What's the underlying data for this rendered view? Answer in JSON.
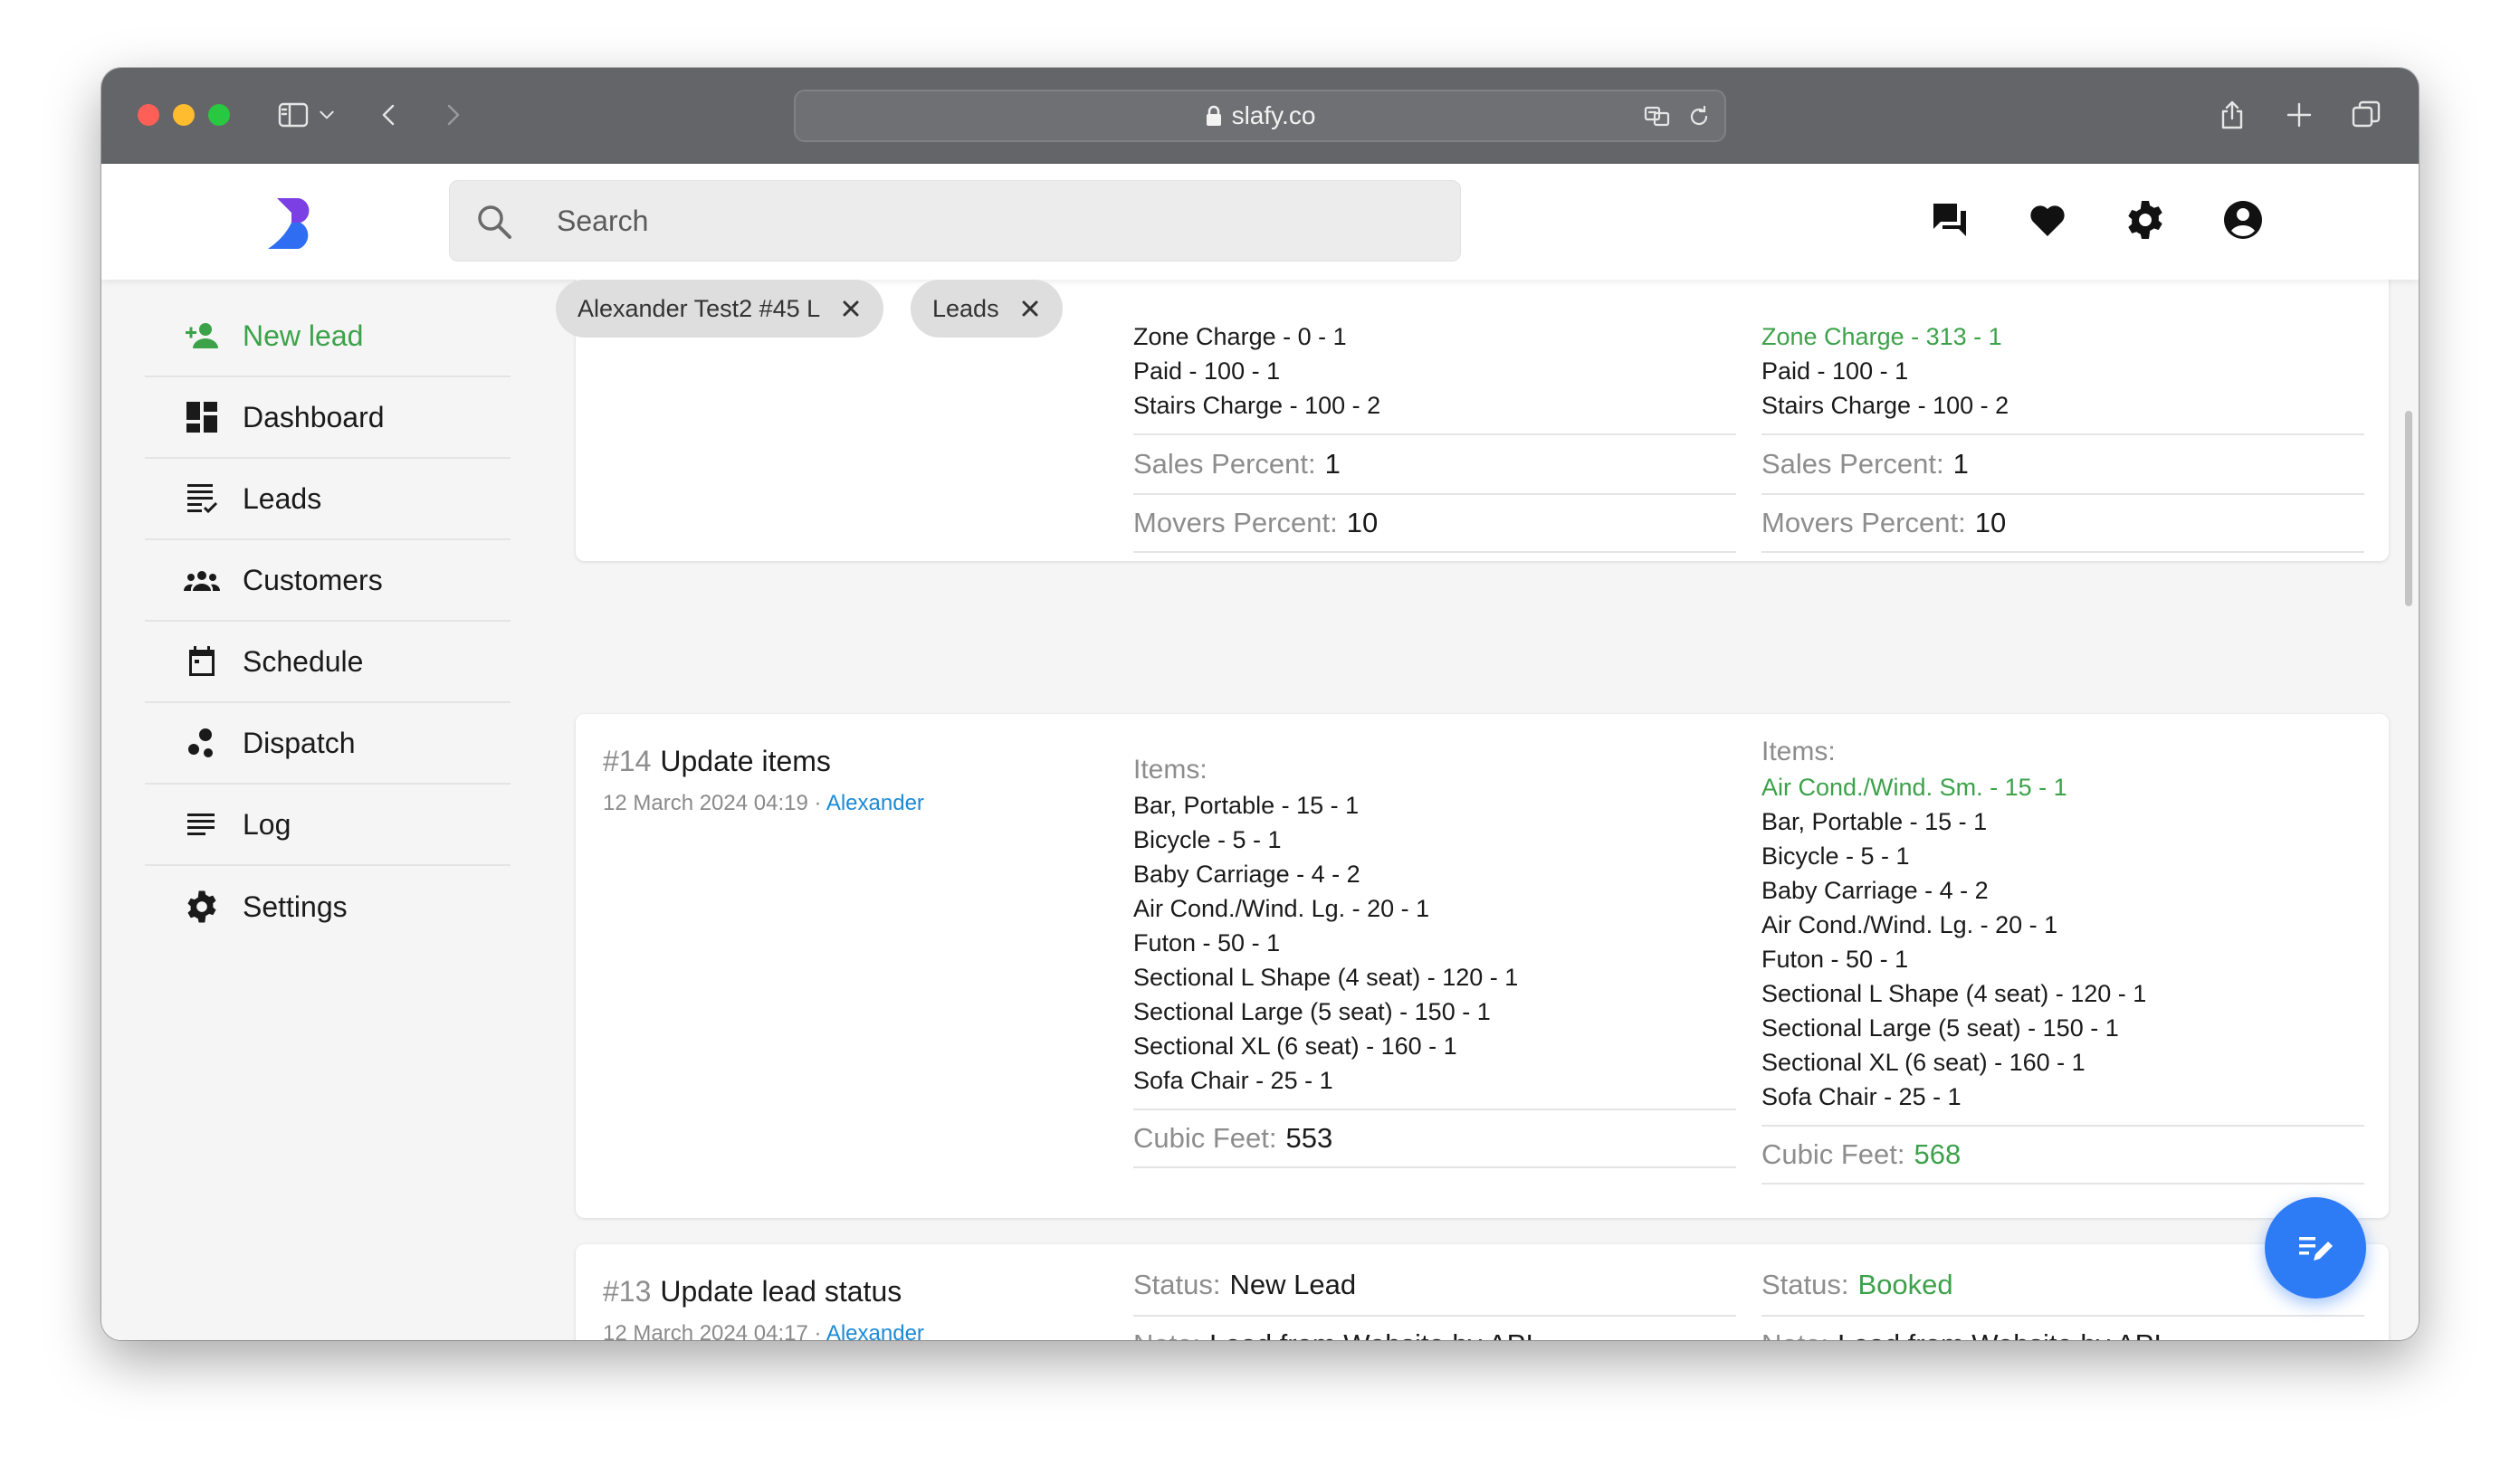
{
  "browser": {
    "url": "slafy.co"
  },
  "search": {
    "placeholder": "Search"
  },
  "tabs": [
    {
      "label": "Alexander Test2 #45 L"
    },
    {
      "label": "Leads"
    }
  ],
  "sidebar": {
    "items": [
      {
        "label": "New lead",
        "icon": "person-add-icon"
      },
      {
        "label": "Dashboard",
        "icon": "dashboard-icon"
      },
      {
        "label": "Leads",
        "icon": "list-check-icon"
      },
      {
        "label": "Customers",
        "icon": "groups-icon"
      },
      {
        "label": "Schedule",
        "icon": "calendar-icon"
      },
      {
        "label": "Dispatch",
        "icon": "dispatch-icon"
      },
      {
        "label": "Log",
        "icon": "log-icon"
      },
      {
        "label": "Settings",
        "icon": "gear-icon"
      }
    ]
  },
  "colors": {
    "accent_green": "#3ca24a",
    "link_blue": "#1b8ad6",
    "fab_blue": "#2e7bf6"
  },
  "cards": {
    "price": {
      "old": {
        "lines": [
          "Zone Charge - 0 - 1",
          "Paid - 100 - 1",
          "Stairs Charge - 100 - 2"
        ],
        "sales_label": "Sales Percent:",
        "sales_value": "1",
        "movers_label": "Movers Percent:",
        "movers_value": "10"
      },
      "new": {
        "lines": [
          "Zone Charge - 313 - 1",
          "Paid - 100 - 1",
          "Stairs Charge - 100 - 2"
        ],
        "sales_label": "Sales Percent:",
        "sales_value": "1",
        "movers_label": "Movers Percent:",
        "movers_value": "10"
      }
    },
    "items": {
      "number": "#14",
      "title": "Update items",
      "date": "12 March 2024 04:19 · ",
      "author": "Alexander",
      "old": {
        "label": "Items:",
        "lines": [
          "Bar, Portable - 15 - 1",
          "Bicycle - 5 - 1",
          "Baby Carriage - 4 - 2",
          "Air Cond./Wind. Lg. - 20 - 1",
          "Futon - 50 - 1",
          "Sectional L Shape (4 seat) - 120 - 1",
          "Sectional Large (5 seat) - 150 - 1",
          "Sectional XL (6 seat) - 160 - 1",
          "Sofa Chair - 25 - 1"
        ],
        "cubic_label": "Cubic Feet:",
        "cubic_value": "553"
      },
      "new": {
        "label": "Items:",
        "added": "Air Cond./Wind. Sm. - 15 - 1",
        "lines": [
          "Bar, Portable - 15 - 1",
          "Bicycle - 5 - 1",
          "Baby Carriage - 4 - 2",
          "Air Cond./Wind. Lg. - 20 - 1",
          "Futon - 50 - 1",
          "Sectional L Shape (4 seat) - 120 - 1",
          "Sectional Large (5 seat) - 150 - 1",
          "Sectional XL (6 seat) - 160 - 1",
          "Sofa Chair - 25 - 1"
        ],
        "cubic_label": "Cubic Feet:",
        "cubic_value": "568"
      }
    },
    "status": {
      "number": "#13",
      "title": "Update lead status",
      "date": "12 March 2024 04:17 · ",
      "author": "Alexander",
      "old": {
        "status_label": "Status:",
        "status_value": "New Lead",
        "note_label": "Note:",
        "note_value": "Lead from Website by API"
      },
      "new": {
        "status_label": "Status:",
        "status_value": "Booked",
        "note_label": "Note:",
        "note_value": "Lead from Website by API"
      }
    }
  }
}
